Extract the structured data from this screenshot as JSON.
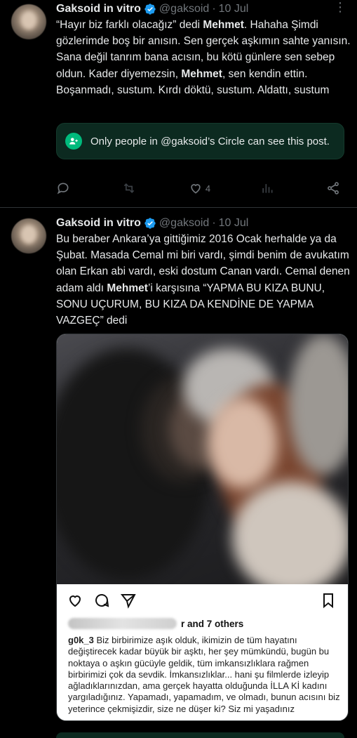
{
  "colors": {
    "background": "#000000",
    "text": "#e7e9ea",
    "muted": "#71767b",
    "verified": "#1d9bf0",
    "circle_bg": "#0c2a20",
    "circle_accent": "#00ba7c"
  },
  "tweets": [
    {
      "author": {
        "name": "Gaksoid in vitro",
        "handle": "@gaksoid",
        "date": "10 Jul",
        "dot": "·"
      },
      "text_parts": [
        "“Hayır biz farklı olacağız” dedi ",
        "Mehmet",
        ". Hahaha Şimdi gözlerimde boş bir anısın. Sen gerçek aşkımın sahte yanısın. Sana değil tanrım bana acısın, bu kötü günlere sen sebep oldun. Kader diyemezsin, ",
        "Mehmet",
        ", sen kendin ettin. Boşanmadı, sustum. Kırdı döktü, sustum. Aldattı, sustum"
      ],
      "circle_notice": "Only people in @gaksoid’s Circle can see this post.",
      "actions": {
        "reply_count": "",
        "retweet_count": "",
        "like_count": "4",
        "views_count": ""
      }
    },
    {
      "author": {
        "name": "Gaksoid in vitro",
        "handle": "@gaksoid",
        "date": "10 Jul",
        "dot": "·"
      },
      "text_parts": [
        "Bu beraber Ankara’ya gittiğimiz 2016 Ocak herhalde ya da Şubat. Masada Cemal mi biri vardı, şimdi benim de avukatım olan Erkan abi vardı, eski dostum Canan vardı. Cemal denen adam aldı ",
        "Mehmet",
        "’i karşısına “YAPMA BU KIZA BUNU, SONU UÇURUM, BU KIZA DA KENDİNE DE YAPMA VAZGEÇ” dedi"
      ],
      "media": {
        "likes_suffix": "r and 7 others",
        "caption_user": "g0k_3",
        "caption_text": " Biz birbirimize aşık olduk, ikimizin de tüm hayatını değiştirecek kadar büyük bir aşktı, her şey mümkündü, bugün bu noktaya o aşkın gücüyle geldik, tüm imkansızlıklara rağmen birbirimizi çok da sevdik. İmkansızlıklar... hani şu filmlerde izleyip ağladıklarınızdan, ama gerçek hayatta olduğunda İLLA Kİ kadını yargıladığınız. Yapamadı, yapamadım, ve olmadı, bunun acısını biz yeterince çekmişizdir, size ne düşer ki? Siz mi yaşadınız"
      }
    }
  ],
  "icons": [
    "more-icon",
    "verified-badge-icon",
    "circle-people-icon",
    "reply-icon",
    "retweet-icon",
    "like-icon",
    "views-icon",
    "share-icon",
    "heart-outline-icon",
    "comment-icon",
    "send-icon",
    "bookmark-icon"
  ]
}
